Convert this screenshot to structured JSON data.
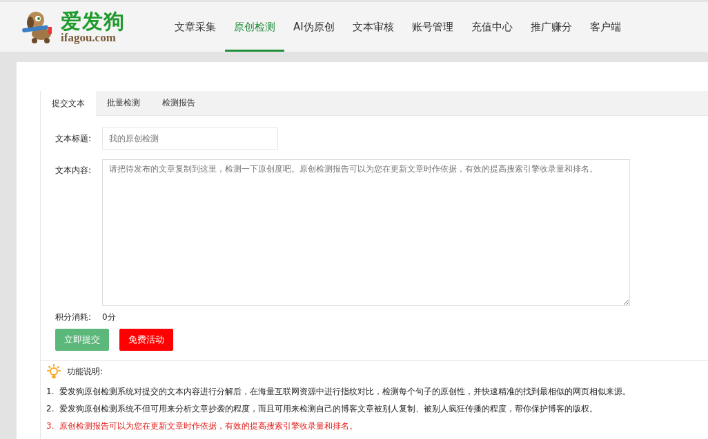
{
  "logo": {
    "title": "爱发狗",
    "domain": "ifagou.com"
  },
  "nav": [
    {
      "label": "文章采集",
      "selected": false
    },
    {
      "label": "原创检测",
      "selected": true
    },
    {
      "label": "AI伪原创",
      "selected": false
    },
    {
      "label": "文本审核",
      "selected": false
    },
    {
      "label": "账号管理",
      "selected": false
    },
    {
      "label": "充值中心",
      "selected": false
    },
    {
      "label": "推广赚分",
      "selected": false
    },
    {
      "label": "客户端",
      "selected": false
    }
  ],
  "tabs": [
    {
      "label": "提交文本",
      "selected": true
    },
    {
      "label": "批量检测",
      "selected": false
    },
    {
      "label": "检测报告",
      "selected": false
    }
  ],
  "form": {
    "title_label": "文本标题:",
    "title_placeholder": "我的原创检测",
    "content_label": "文本内容:",
    "content_placeholder": "请把待发布的文章复制到这里，检测一下原创度吧。原创检测报告可以为您在更新文章时作依据，有效的提高搜索引擎收录量和排名。",
    "cost_label": "积分消耗:",
    "cost_value": "0分"
  },
  "buttons": [
    {
      "label": "立即提交",
      "kind": "submit"
    },
    {
      "label": "免费活动",
      "kind": "promo"
    }
  ],
  "notes": {
    "heading": "功能说明:",
    "items": [
      {
        "number": "1.",
        "text": "爱发狗原创检测系统对提交的文本内容进行分解后，在海量互联网资源中进行指纹对比，检测每个句子的原创性，并快速精准的找到最相似的网页相似来源。",
        "highlight": false
      },
      {
        "number": "2.",
        "text": "爱发狗原创检测系统不但可用来分析文章抄袭的程度，而且可用来检测自己的博客文章被别人复制、被别人疯狂传播的程度，帮你保护博客的版权。",
        "highlight": false
      },
      {
        "number": "3.",
        "text": "原创检测报告可以为您在更新文章时作依据，有效的提高搜索引擎收录量和排名。",
        "highlight": true
      }
    ]
  }
}
